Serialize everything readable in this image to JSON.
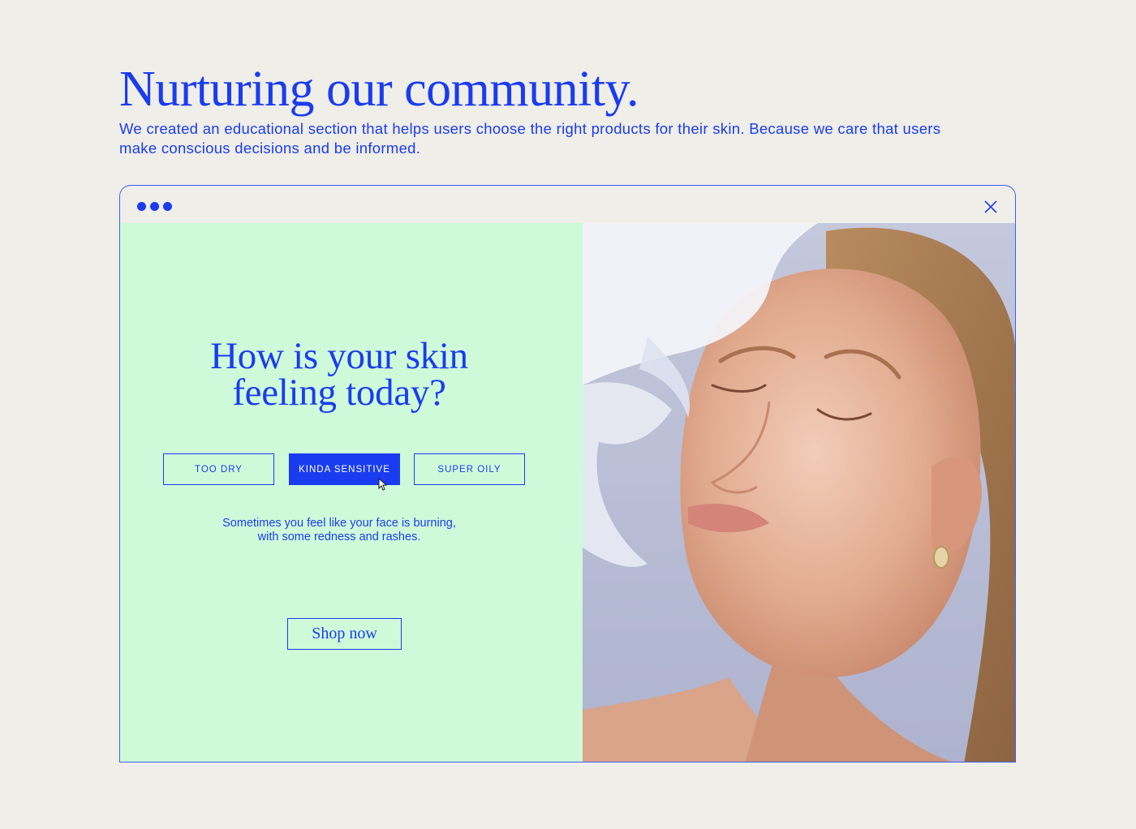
{
  "header": {
    "title": "Nurturing our community.",
    "description": "We created an educational section that helps users choose the right products for their skin. Because we care that users make conscious decisions and be informed."
  },
  "window": {
    "close_icon": "close-icon",
    "dots_icon": "window-dots-icon"
  },
  "quiz": {
    "question_line1": "How is your skin",
    "question_line2": "feeling today?",
    "options": [
      {
        "label": "TOO DRY",
        "selected": false
      },
      {
        "label": "KINDA SENSITIVE",
        "selected": true
      },
      {
        "label": "SUPER OILY",
        "selected": false
      }
    ],
    "description_line1": "Sometimes you feel like your face is burning,",
    "description_line2": "with some redness and rashes.",
    "shop_label": "Shop now"
  },
  "colors": {
    "accent": "#1a3cf0",
    "panel_bg": "#cefad9",
    "page_bg": "#efeee9"
  }
}
